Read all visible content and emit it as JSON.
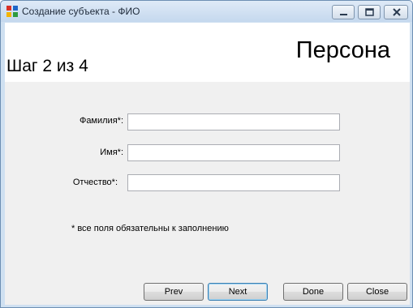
{
  "window": {
    "title": "Создание субъекта - ФИО"
  },
  "header": {
    "title": "Персона",
    "step": "Шаг 2 из 4"
  },
  "form": {
    "fields": [
      {
        "label": "Фамилия*:",
        "value": ""
      },
      {
        "label": "Имя*:",
        "value": ""
      },
      {
        "label": "Отчество*:",
        "value": ""
      }
    ],
    "note": "* все поля обязательны к заполнению"
  },
  "buttons": {
    "prev": "Prev",
    "next": "Next",
    "done": "Done",
    "close": "Close"
  }
}
